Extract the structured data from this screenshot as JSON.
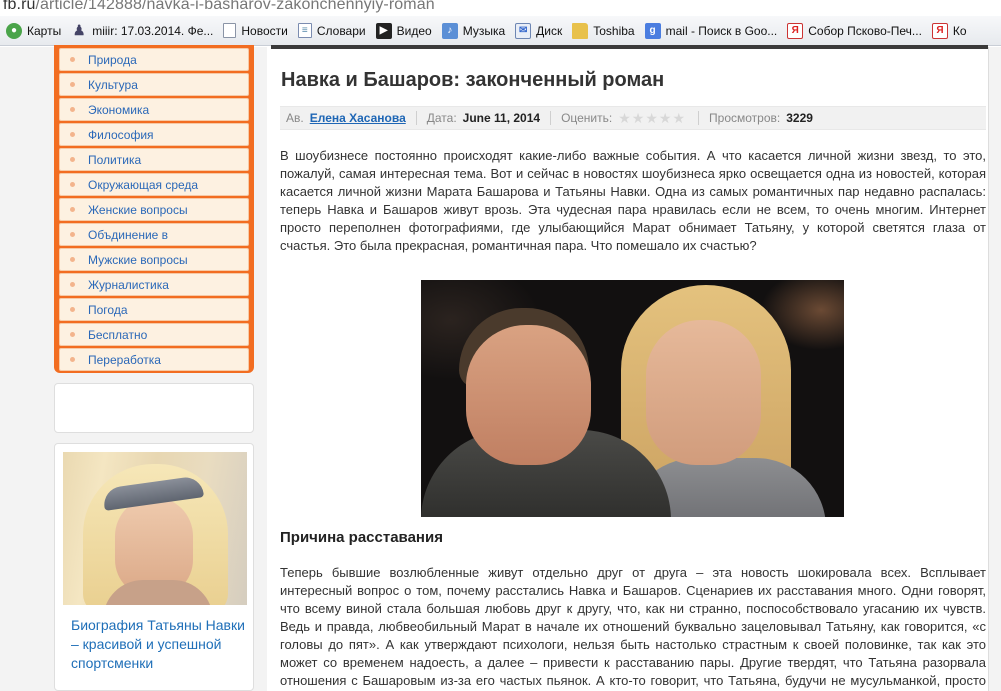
{
  "browser": {
    "url_host": "fb.ru",
    "url_path": "/article/142888/navka-i-basharov-zakonchennyiy-roman",
    "bookmarks": [
      {
        "label": "Карты",
        "icon": "maps-icon",
        "glyph": "●"
      },
      {
        "label": "miiir: 17.03.2014. Фе...",
        "icon": "user-icon",
        "glyph": "♟"
      },
      {
        "label": "Новости",
        "icon": "page-icon",
        "glyph": ""
      },
      {
        "label": "Словари",
        "icon": "dictionary-icon",
        "glyph": "≡"
      },
      {
        "label": "Видео",
        "icon": "video-icon",
        "glyph": "▶"
      },
      {
        "label": "Музыка",
        "icon": "music-icon",
        "glyph": "♪"
      },
      {
        "label": "Диск",
        "icon": "mail-icon",
        "glyph": "✉"
      },
      {
        "label": "Toshiba",
        "icon": "folder-icon",
        "glyph": ""
      },
      {
        "label": "mail - Поиск в Goo...",
        "icon": "google-icon",
        "glyph": "g"
      },
      {
        "label": "Собор Псково-Печ...",
        "icon": "yandex-icon",
        "glyph": "Я"
      },
      {
        "label": "Ко",
        "icon": "yandex-icon",
        "glyph": "Я"
      }
    ]
  },
  "sidebar": {
    "categories": [
      "Природа",
      "Культура",
      "Экономика",
      "Философия",
      "Политика",
      "Окружающая среда",
      "Женские вопросы",
      "Объдинение в",
      "Мужские вопросы",
      "Журналистика",
      "Погода",
      "Бесплатно",
      "Переработка"
    ],
    "card_caption": "Биография Татьяны Навки – красивой и успешной спортсменки"
  },
  "article": {
    "title": "Навка и Башаров: законченный роман",
    "meta": {
      "author_label": "Ав.",
      "author": "Елена Хасанова",
      "date_label": "Дата:",
      "date": "June 11, 2014",
      "rate_label": "Оценить:",
      "rating_stars": 5,
      "rating_value": 0,
      "views_label": "Просмотров:",
      "views": "3229"
    },
    "intro": "В шоубизнесе постоянно происходят какие-либо важные события. А что касается личной жизни звезд, то это, пожалуй, самая интересная тема. Вот и сейчас в новостях шоубизнеса ярко освещается одна из новостей, которая касается личной жизни Марата Башарова и Татьяны Навки. Одна из самых романтичных пар недавно распалась: теперь Навка и Башаров живут врозь. Эта чудесная пара нравилась если не всем, то очень многим. Интернет просто переполнен фотографиями, где улыбающийся Марат обнимает Татьяну, у которой светятся глаза от счастья. Это была прекрасная, романтичная пара. Что помешало их счастью?",
    "section_heading": "Причина расставания",
    "section_text": "Теперь бывшие возлюбленные живут отдельно друг от друга – эта новость шокировала всех. Всплывает интересный вопрос о том, почему расстались Навка и Башаров. Сценариев их расставания много. Одни говорят, что всему виной стала большая любовь друг к другу, что, как ни странно, поспособствовало угасанию их чувств. Ведь и правда, любвеобильный Марат в начале их отношений буквально зацеловывал Татьяну, как говорится, «с головы до пят». А как утверждают психологи, нельзя быть настолько страстным к своей половинке, так как это может со временем надоесть, а далее – привести к расставанию пары. Другие твердят, что Татьяна разорвала отношения с Башаровым из-за его частых пьянок. А кто-то говорит, что Татьяна, будучи не мусульманкой, просто не была одобрена его семьей."
  },
  "colors": {
    "menu_orange": "#f26d21",
    "menu_item_bg": "#fdf1e1",
    "link_blue": "#2a68b8"
  }
}
